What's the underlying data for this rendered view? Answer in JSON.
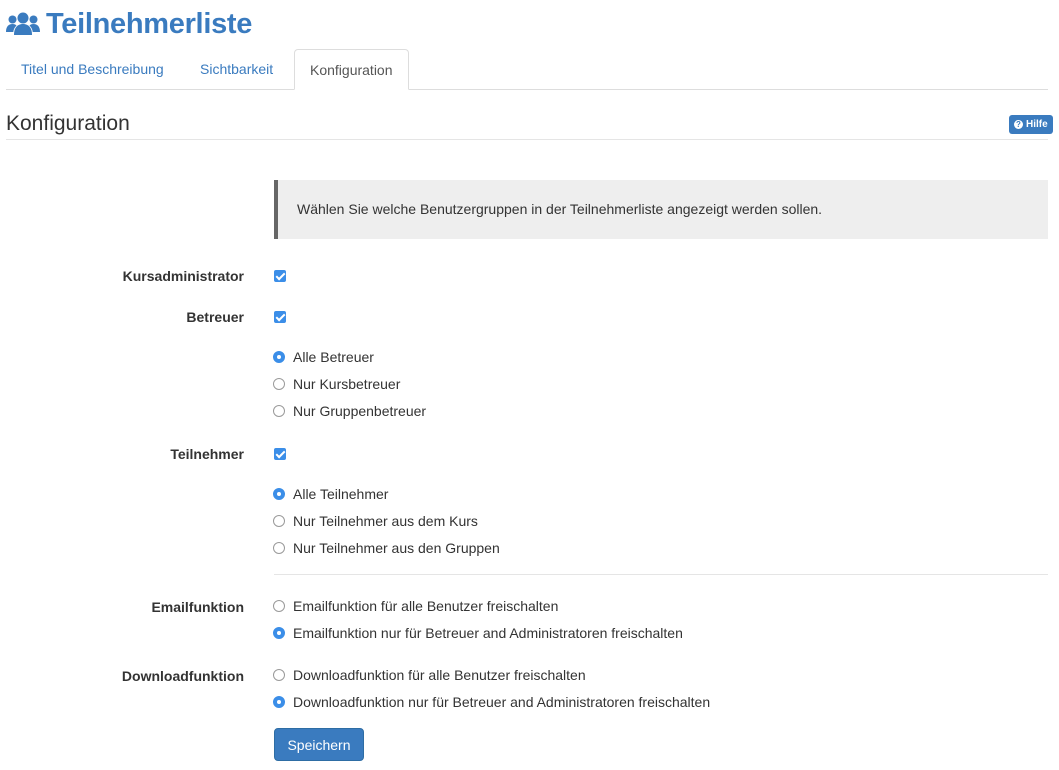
{
  "header": {
    "title": "Teilnehmerliste",
    "icon": "users-icon"
  },
  "tabs": [
    {
      "label": "Titel und Beschreibung",
      "active": false
    },
    {
      "label": "Sichtbarkeit",
      "active": false
    },
    {
      "label": "Konfiguration",
      "active": true
    }
  ],
  "section": {
    "title": "Konfiguration",
    "help_label": "Hilfe"
  },
  "info": "Wählen Sie welche Benutzergruppen in der Teilnehmerliste angezeigt werden sollen.",
  "form": {
    "kursadmin": {
      "label": "Kursadministrator",
      "checked": true
    },
    "betreuer": {
      "label": "Betreuer",
      "checked": true,
      "options": [
        {
          "label": "Alle Betreuer",
          "selected": true
        },
        {
          "label": "Nur Kursbetreuer",
          "selected": false
        },
        {
          "label": "Nur Gruppenbetreuer",
          "selected": false
        }
      ]
    },
    "teilnehmer": {
      "label": "Teilnehmer",
      "checked": true,
      "options": [
        {
          "label": "Alle Teilnehmer",
          "selected": true
        },
        {
          "label": "Nur Teilnehmer aus dem Kurs",
          "selected": false
        },
        {
          "label": "Nur Teilnehmer aus den Gruppen",
          "selected": false
        }
      ]
    },
    "email": {
      "label": "Emailfunktion",
      "options": [
        {
          "label": "Emailfunktion für alle Benutzer freischalten",
          "selected": false
        },
        {
          "label": "Emailfunktion nur für Betreuer and Administratoren freischalten",
          "selected": true
        }
      ]
    },
    "download": {
      "label": "Downloadfunktion",
      "options": [
        {
          "label": "Downloadfunktion für alle Benutzer freischalten",
          "selected": false
        },
        {
          "label": "Downloadfunktion nur für Betreuer and Administratoren freischalten",
          "selected": true
        }
      ]
    },
    "save_label": "Speichern"
  },
  "colors": {
    "accent": "#3a7bbf",
    "control": "#3b8ee8"
  }
}
